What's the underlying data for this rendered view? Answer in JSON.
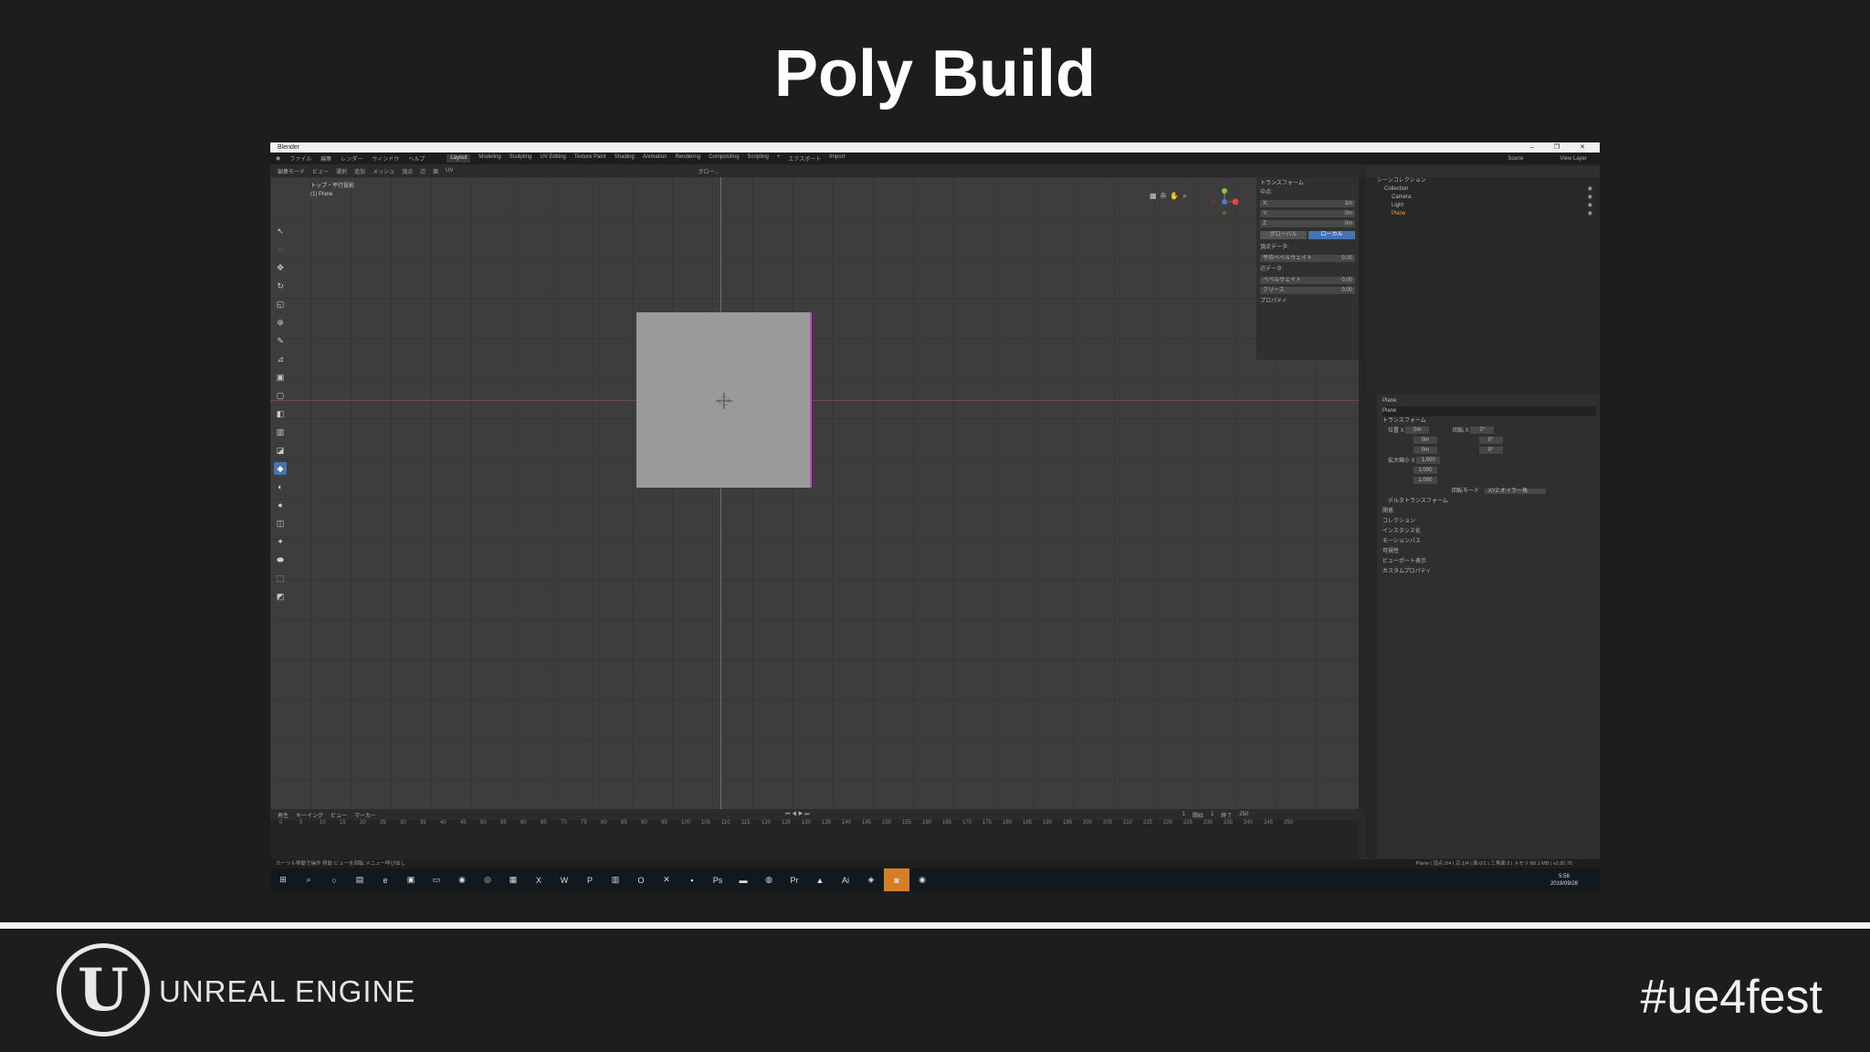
{
  "slide": {
    "title": "Poly Build",
    "brand": "UNREAL ENGINE",
    "hashtag": "#ue4fest",
    "brand_glyph": "U"
  },
  "window": {
    "title": "Blender",
    "controls": "– ❐ ✕"
  },
  "menus": [
    "ファイル",
    "編集",
    "レンダー",
    "ウィンドウ",
    "ヘルプ"
  ],
  "workspaces": [
    "Layout",
    "Modeling",
    "Sculpting",
    "UV Editing",
    "Texture Paint",
    "Shading",
    "Animation",
    "Rendering",
    "Compositing",
    "Scripting",
    "+"
  ],
  "menubar_right": {
    "export": "エクスポート",
    "import": "Import",
    "scene": "Scene",
    "view_layer": "View Layer"
  },
  "viewport_header": [
    "編集モード",
    "ビュー",
    "選択",
    "追加",
    "メッシュ",
    "頂点",
    "辺",
    "面",
    "UV"
  ],
  "viewport": {
    "view_name": "トップ・平行投影",
    "object": "(1) Plane",
    "orientation": "グロー..."
  },
  "npanel": {
    "transform": "トランスフォーム",
    "median": "中点:",
    "rows": [
      {
        "k": "X:",
        "v": "1m"
      },
      {
        "k": "Y:",
        "v": "0m"
      },
      {
        "k": "Z:",
        "v": "0m"
      }
    ],
    "global": "グローバル",
    "local": "ローカル",
    "vertex_data": "頂点データ:",
    "bevel_weight_avg": {
      "k": "平均ベベルウェイト",
      "v": "0.00"
    },
    "edge_data": "辺データ:",
    "bevel_weight": {
      "k": "ベベルウェイト",
      "v": "0.00"
    },
    "crease": {
      "k": "クリース",
      "v": "0.00"
    },
    "properties": "プロパティ"
  },
  "outliner": {
    "root": "シーンコレクション",
    "items": [
      "Collection",
      "Camera",
      "Light",
      "Plane"
    ]
  },
  "properties": {
    "object": "Plane",
    "data": "Plane",
    "transform": "トランスフォーム",
    "location": "位置 X",
    "rotation": "回転 X",
    "scale": "拡大縮小 X",
    "loc_vals": [
      "0m",
      "0m",
      "0m"
    ],
    "rot_vals": [
      "0°",
      "0°",
      "0°"
    ],
    "scale_vals": [
      "1.000",
      "1.000",
      "1.000"
    ],
    "rot_mode_label": "回転モード",
    "rot_mode": "XYZ オイラー角",
    "sections": [
      "デルタトランスフォーム",
      "関係",
      "コレクション",
      "インスタンス化",
      "モーションパス",
      "可視性",
      "ビューポート表示",
      "カスタムプロパティ"
    ]
  },
  "timeline": {
    "menus": [
      "再生",
      "キーイング",
      "ビュー",
      "マーカー"
    ],
    "current": "1",
    "start_label": "開始",
    "start": "1",
    "end_label": "終了",
    "end": "250",
    "ticks": [
      "0",
      "5",
      "10",
      "15",
      "20",
      "25",
      "30",
      "35",
      "40",
      "45",
      "50",
      "55",
      "60",
      "65",
      "70",
      "75",
      "80",
      "85",
      "90",
      "95",
      "100",
      "105",
      "110",
      "115",
      "120",
      "125",
      "130",
      "135",
      "140",
      "145",
      "150",
      "155",
      "160",
      "165",
      "170",
      "175",
      "180",
      "185",
      "190",
      "195",
      "200",
      "205",
      "210",
      "215",
      "220",
      "225",
      "230",
      "235",
      "240",
      "245",
      "250"
    ]
  },
  "statusbar": {
    "left": "カーソル移動で操作  移動     ビューを回転          メニュー呼び出し",
    "right": "Plane | 頂点:2/4 | 辺:1/4 | 面:0/1 | 三角面:2 | メモリ:88.1 MB | v2.80.75"
  },
  "taskbar": {
    "time": "5:58",
    "date": "2019/09/28"
  }
}
